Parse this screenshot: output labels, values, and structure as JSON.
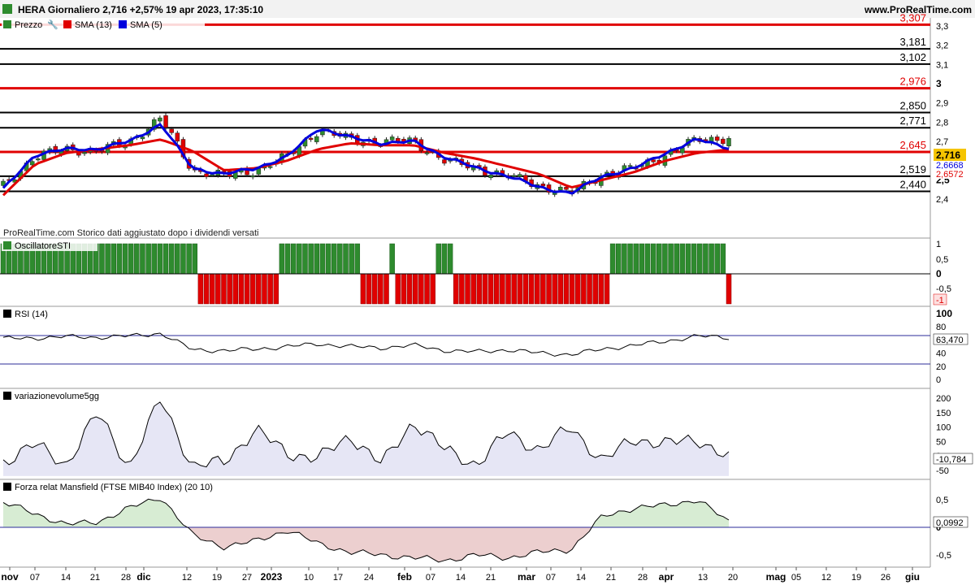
{
  "header": {
    "title": "HERA Giornaliero 2,716 +2,57% 19 apr 2023, 17:35:10",
    "site": "www.ProRealTime.com"
  },
  "price_panel": {
    "legend": [
      {
        "label": "Prezzo",
        "color": "#2e8b2e"
      },
      {
        "label": "SMA (13)",
        "color": "#e00000"
      },
      {
        "label": "SMA (5)",
        "color": "#0000dd"
      }
    ],
    "watermark": "ProRealTime.com Storico dati aggiustato dopo i dividendi versati",
    "axis_ticks": [
      "3,3",
      "3,2",
      "3,1",
      "3",
      "2,9",
      "2,8",
      "2,7",
      "2,6",
      "2,5",
      "2,4"
    ],
    "badges": {
      "price": "2,716",
      "sma5": "2,6668",
      "sma13": "2,6572"
    }
  },
  "chart_data": [
    {
      "type": "candlestick",
      "title": "HERA Giornaliero",
      "ylim": [
        2.36,
        3.33
      ],
      "x": [
        "07 nov",
        "14 nov",
        "21 nov",
        "28 nov",
        "05 dic",
        "12 dic",
        "19 dic",
        "27 dic",
        "02 gen 2023",
        "09 gen",
        "16 gen",
        "23 gen",
        "30 gen",
        "06 feb",
        "13 feb",
        "20 feb",
        "27 feb",
        "06 mar",
        "13 mar",
        "20 mar",
        "27 mar",
        "03 apr",
        "10 apr",
        "17 apr"
      ],
      "close": [
        2.47,
        2.62,
        2.66,
        2.65,
        2.7,
        2.82,
        2.55,
        2.52,
        2.55,
        2.62,
        2.76,
        2.71,
        2.7,
        2.7,
        2.6,
        2.56,
        2.52,
        2.47,
        2.43,
        2.53,
        2.56,
        2.63,
        2.71,
        2.716
      ],
      "sma13": [
        2.42,
        2.58,
        2.64,
        2.66,
        2.68,
        2.71,
        2.65,
        2.55,
        2.56,
        2.6,
        2.66,
        2.69,
        2.68,
        2.68,
        2.64,
        2.61,
        2.57,
        2.53,
        2.46,
        2.5,
        2.54,
        2.6,
        2.64,
        2.6572
      ],
      "sma5": [
        2.45,
        2.63,
        2.66,
        2.66,
        2.7,
        2.79,
        2.56,
        2.53,
        2.56,
        2.62,
        2.77,
        2.72,
        2.69,
        2.7,
        2.62,
        2.56,
        2.52,
        2.46,
        2.43,
        2.52,
        2.56,
        2.64,
        2.71,
        2.6668
      ],
      "levels": [
        {
          "value": 3.307,
          "label": "3,307",
          "color": "#e00000"
        },
        {
          "value": 3.181,
          "label": "3,181",
          "color": "#000000"
        },
        {
          "value": 3.102,
          "label": "3,102",
          "color": "#000000"
        },
        {
          "value": 2.976,
          "label": "2,976",
          "color": "#e00000"
        },
        {
          "value": 2.85,
          "label": "2,850",
          "color": "#000000"
        },
        {
          "value": 2.771,
          "label": "2,771",
          "color": "#000000"
        },
        {
          "value": 2.645,
          "label": "2,645",
          "color": "#e00000"
        },
        {
          "value": 2.519,
          "label": "2,519",
          "color": "#000000"
        },
        {
          "value": 2.44,
          "label": "2,440",
          "color": "#000000"
        }
      ]
    },
    {
      "type": "bar",
      "title": "OscillatoreSTI",
      "ylim": [
        -1,
        1
      ],
      "series_pattern": "weekly blocks of +1 (green) / -1 (red)",
      "blocks": [
        {
          "from": "07 nov",
          "to": "12 dic",
          "value": 1
        },
        {
          "from": "13 dic",
          "to": "06 gen",
          "value": -1
        },
        {
          "from": "09 gen",
          "to": "27 gen",
          "value": 1
        },
        {
          "from": "30 gen",
          "to": "06 feb",
          "value": -1
        },
        {
          "from": "07 feb",
          "to": "07 feb",
          "value": 1
        },
        {
          "from": "08 feb",
          "to": "17 feb",
          "value": -1
        },
        {
          "from": "20 feb",
          "to": "22 feb",
          "value": 1
        },
        {
          "from": "23 feb",
          "to": "20 mar",
          "value": -1
        },
        {
          "from": "21 mar",
          "to": "17 apr",
          "value": 1
        },
        {
          "from": "18 apr",
          "to": "19 apr",
          "value": -1
        }
      ],
      "axis_ticks": [
        "1",
        "0,5",
        "0",
        "-0,5",
        "-1"
      ],
      "badge": "-1"
    },
    {
      "type": "line",
      "title": "RSI (14)",
      "ylim": [
        0,
        100
      ],
      "values": [
        62,
        63,
        65,
        64,
        66,
        70,
        45,
        44,
        46,
        50,
        54,
        50,
        48,
        52,
        44,
        42,
        45,
        40,
        38,
        46,
        52,
        58,
        66,
        63.47
      ],
      "axis_ticks": [
        "100",
        "80",
        "60",
        "40",
        "20",
        "0"
      ],
      "badge": "63,470"
    },
    {
      "type": "area",
      "title": "variazionevolume5gg",
      "ylim": [
        -70,
        210
      ],
      "values": [
        -20,
        40,
        -30,
        150,
        -40,
        200,
        -40,
        -20,
        90,
        10,
        -10,
        70,
        -30,
        120,
        20,
        -30,
        80,
        20,
        100,
        -20,
        60,
        40,
        60,
        -10.784
      ],
      "axis_ticks": [
        "200",
        "150",
        "100",
        "50",
        "0",
        "-50"
      ],
      "badge": "-10,784"
    },
    {
      "type": "area",
      "title": "Forza relat Mansfield (FTSE MIB40 Index) (20 10)",
      "ylim": [
        -0.75,
        0.75
      ],
      "values": [
        0.45,
        0.25,
        0.05,
        0.1,
        0.35,
        0.55,
        -0.15,
        -0.35,
        -0.25,
        -0.05,
        -0.3,
        -0.45,
        -0.5,
        -0.55,
        -0.6,
        -0.5,
        -0.55,
        -0.45,
        -0.4,
        0.2,
        0.35,
        0.4,
        0.5,
        0.0992
      ],
      "axis_ticks": [
        "0,5",
        "0",
        "-0,5"
      ],
      "badge": "0,0992"
    }
  ],
  "panels": {
    "osc_label": "OscillatoreSTI",
    "rsi_label": "RSI (14)",
    "vol_label": "variazionevolume5gg",
    "mans_label": "Forza relat Mansfield (FTSE MIB40 Index) (20 10)"
  },
  "time_axis": {
    "labels": [
      "nov",
      "07",
      "14",
      "21",
      "28",
      "dic",
      "12",
      "19",
      "27",
      "2023",
      "10",
      "17",
      "24",
      "feb",
      "07",
      "14",
      "21",
      "mar",
      "07",
      "14",
      "21",
      "28",
      "apr",
      "13",
      "20",
      "mag",
      "05",
      "12",
      "19",
      "26",
      "giu"
    ]
  },
  "colors": {
    "up": "#2e8b2e",
    "down": "#e00000",
    "sma13": "#e00000",
    "sma5": "#0000dd",
    "rsi_band": "#2b2b9a"
  }
}
